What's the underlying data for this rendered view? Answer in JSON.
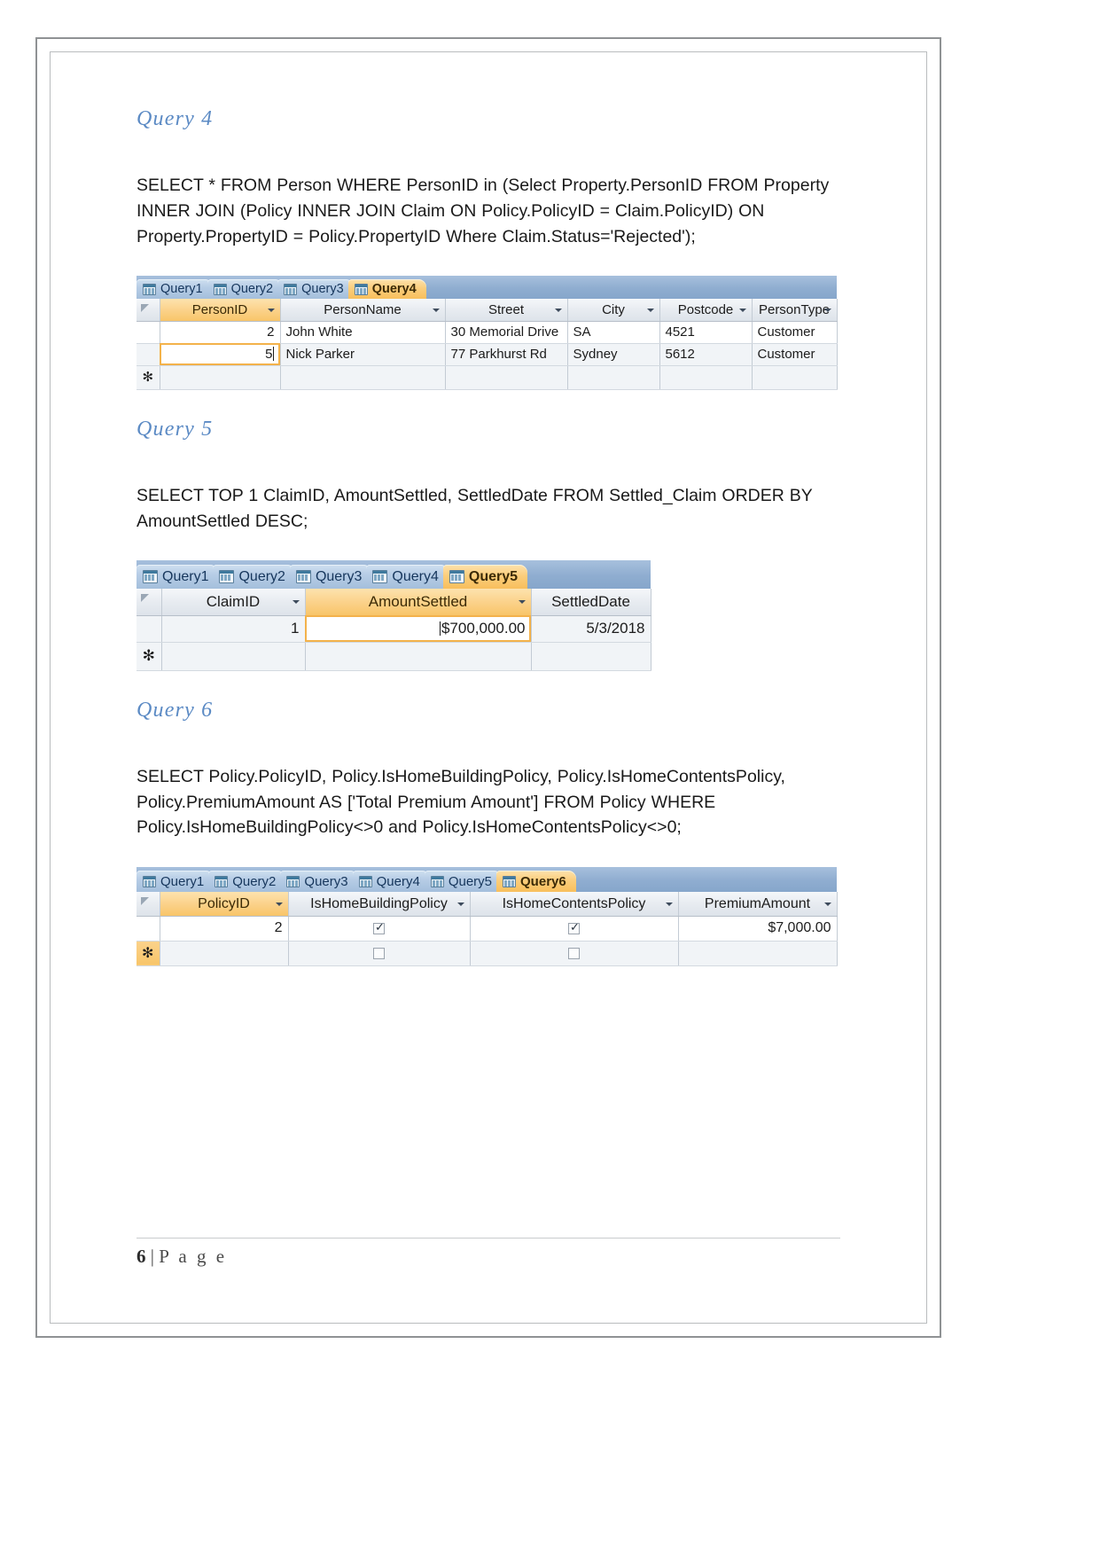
{
  "document": {
    "page_footer": {
      "page_number": "6",
      "separator": "|",
      "page_word": "P a g e"
    }
  },
  "sections": [
    {
      "heading": "Query 4",
      "sql": "SELECT * FROM Person WHERE PersonID in (Select Property.PersonID FROM Property INNER JOIN (Policy INNER JOIN Claim ON Policy.PolicyID = Claim.PolicyID) ON Property.PropertyID = Policy.PropertyID Where Claim.Status='Rejected');",
      "access": {
        "tabs": [
          {
            "label": "Query1",
            "active": false
          },
          {
            "label": "Query2",
            "active": false
          },
          {
            "label": "Query3",
            "active": false
          },
          {
            "label": "Query4",
            "active": true
          }
        ],
        "columns": [
          {
            "label": "PersonID",
            "accent": true
          },
          {
            "label": "PersonName",
            "accent": false
          },
          {
            "label": "Street",
            "accent": false
          },
          {
            "label": "City",
            "accent": false
          },
          {
            "label": "Postcode",
            "accent": false
          },
          {
            "label": "PersonType",
            "accent": false
          }
        ],
        "rows": [
          {
            "selected": false,
            "cells": [
              "2",
              "John White",
              "30 Memorial Drive",
              "SA",
              "4521",
              "Customer"
            ]
          },
          {
            "selected": true,
            "cells": [
              "5",
              "Nick Parker",
              "77 Parkhurst Rd",
              "Sydney",
              "5612",
              "Customer"
            ]
          }
        ],
        "new_row_marker": "✻"
      }
    },
    {
      "heading": "Query 5",
      "sql": "SELECT TOP 1 ClaimID, AmountSettled, SettledDate FROM Settled_Claim ORDER BY AmountSettled DESC;",
      "access": {
        "tabs": [
          {
            "label": "Query1",
            "active": false
          },
          {
            "label": "Query2",
            "active": false
          },
          {
            "label": "Query3",
            "active": false
          },
          {
            "label": "Query4",
            "active": false
          },
          {
            "label": "Query5",
            "active": true
          }
        ],
        "columns": [
          {
            "label": "ClaimID",
            "accent": false
          },
          {
            "label": "AmountSettled",
            "accent": true
          },
          {
            "label": "SettledDate",
            "accent": false
          }
        ],
        "rows": [
          {
            "selected": true,
            "cells": [
              "1",
              "$700,000.00",
              "5/3/2018"
            ]
          }
        ],
        "new_row_marker": "✻"
      }
    },
    {
      "heading": "Query 6",
      "sql": "SELECT Policy.PolicyID, Policy.IsHomeBuildingPolicy, Policy.IsHomeContentsPolicy, Policy.PremiumAmount AS ['Total Premium Amount'] FROM Policy WHERE Policy.IsHomeBuildingPolicy<>0 and Policy.IsHomeContentsPolicy<>0;",
      "access": {
        "tabs": [
          {
            "label": "Query1",
            "active": false
          },
          {
            "label": "Query2",
            "active": false
          },
          {
            "label": "Query3",
            "active": false
          },
          {
            "label": "Query4",
            "active": false
          },
          {
            "label": "Query5",
            "active": false
          },
          {
            "label": "Query6",
            "active": true
          }
        ],
        "columns": [
          {
            "label": "PolicyID",
            "accent": true
          },
          {
            "label": "IsHomeBuildingPolicy",
            "accent": false
          },
          {
            "label": "IsHomeContentsPolicy",
            "accent": false
          },
          {
            "label": "PremiumAmount",
            "accent": false
          }
        ],
        "rows": [
          {
            "selected": false,
            "cells": [
              "2",
              "checked",
              "checked",
              "$7,000.00"
            ]
          }
        ],
        "new_row_marker": "✻"
      }
    }
  ],
  "colors": {
    "heading_blue": "#5b8ac4",
    "tab_active": "#f8bf5c",
    "tab_inactive": "#a4bfdc",
    "tabstrip": "#8fadd0",
    "selection_orange": "#f3b24b"
  }
}
